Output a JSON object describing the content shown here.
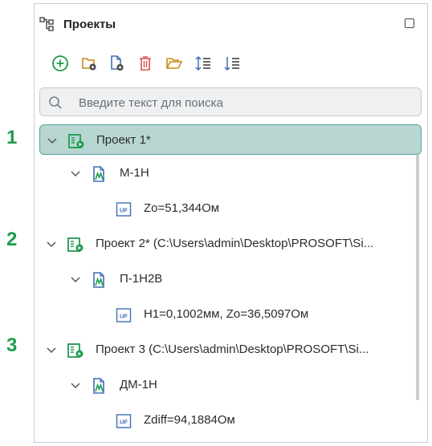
{
  "panel": {
    "title": "Проекты",
    "search": {
      "placeholder": "Введите текст для поиска",
      "value": ""
    },
    "toolbar": [
      {
        "name": "add-button",
        "icon": "plus-circle-icon"
      },
      {
        "name": "add-folder-button",
        "icon": "folder-plus-icon"
      },
      {
        "name": "add-file-button",
        "icon": "file-plus-icon"
      },
      {
        "name": "delete-button",
        "icon": "trash-icon"
      },
      {
        "name": "open-folder-button",
        "icon": "open-folder-icon"
      },
      {
        "name": "sort-ascending-button",
        "icon": "sort-asc-icon"
      },
      {
        "name": "sort-descending-button",
        "icon": "sort-desc-icon"
      }
    ]
  },
  "tree": [
    {
      "label": "Проект 1*",
      "level": 0,
      "type": "project",
      "selected": true
    },
    {
      "label": "М-1Н",
      "level": 1,
      "type": "model"
    },
    {
      "label": "Zo=51,344Ом",
      "level": 2,
      "type": "param"
    },
    {
      "label": "Проект 2* (C:\\Users\\admin\\Desktop\\PROSOFT\\Si...",
      "level": 0,
      "type": "project"
    },
    {
      "label": "П-1Н2В",
      "level": 1,
      "type": "model"
    },
    {
      "label": "H1=0,1002мм, Zo=36,5097Ом",
      "level": 2,
      "type": "param"
    },
    {
      "label": "Проект 3 (C:\\Users\\admin\\Desktop\\PROSOFT\\Si...",
      "level": 0,
      "type": "project"
    },
    {
      "label": "ДМ-1Н",
      "level": 1,
      "type": "model"
    },
    {
      "label": "Zdiff=94,1884Ом",
      "level": 2,
      "type": "param"
    }
  ],
  "annotations": [
    "1",
    "2",
    "3"
  ],
  "colors": {
    "accent": "#1e9b4e",
    "selected_bg": "#b7d6d2",
    "selected_border": "#59a39b",
    "delete": "#d9534f",
    "folder": "#c98a16"
  }
}
